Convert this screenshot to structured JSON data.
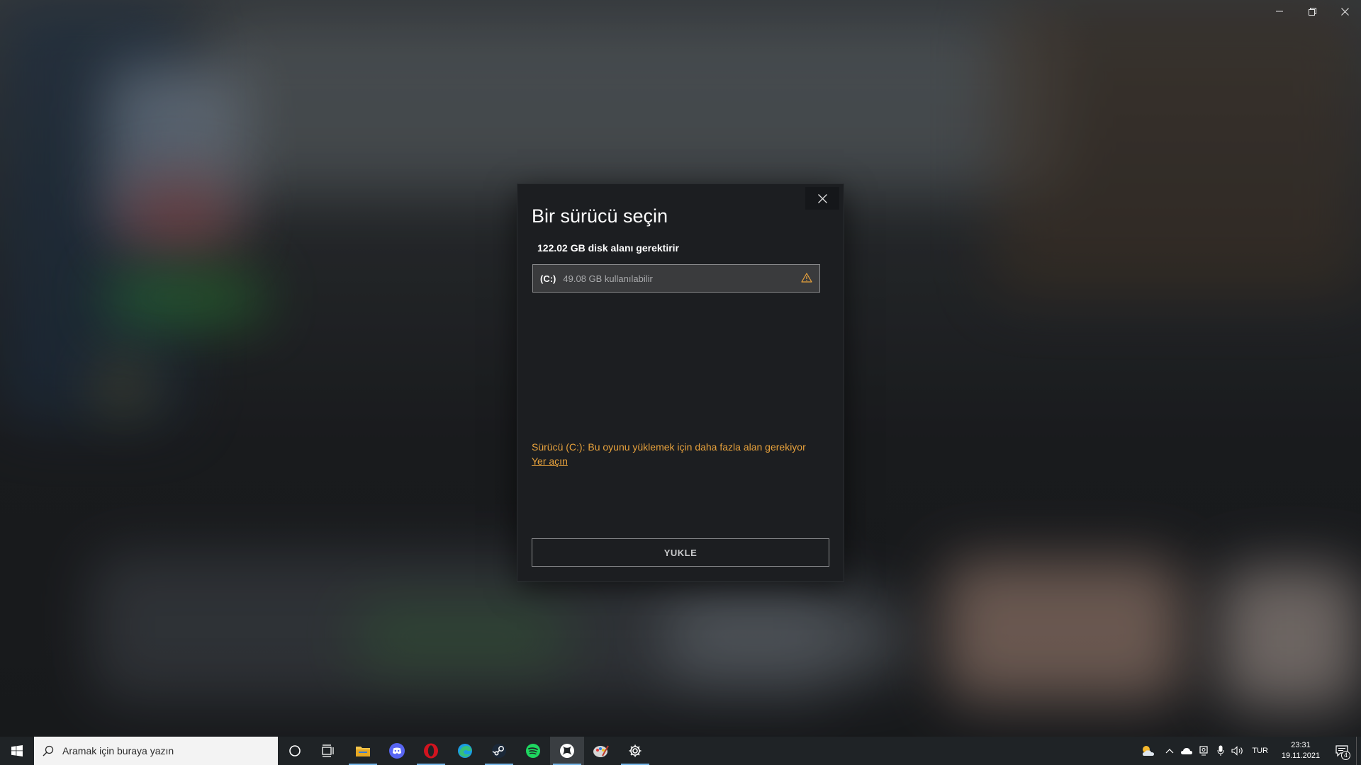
{
  "window": {
    "controls": {
      "minimize_icon": "minimize-icon",
      "restore_icon": "restore-icon",
      "close_icon": "close-icon"
    }
  },
  "dialog": {
    "title": "Bir sürücü seçin",
    "required_space": "122.02 GB disk alanı gerektirir",
    "drive": {
      "letter": "(C:)",
      "free_space": "49.08 GB kullanılabilir",
      "status_icon": "warning-icon"
    },
    "warning_text": "Sürücü (C:): Bu oyunu yüklemek için daha fazla alan gerekiyor",
    "free_up_link": "Yer açın",
    "install_label": "YUKLE"
  },
  "taskbar": {
    "search_placeholder": "Aramak için buraya yazın",
    "apps": [
      {
        "name": "cortana",
        "icon": "cortana-icon"
      },
      {
        "name": "task-view",
        "icon": "task-view-icon"
      },
      {
        "name": "file-explorer",
        "icon": "folder-icon"
      },
      {
        "name": "discord",
        "icon": "discord-icon"
      },
      {
        "name": "opera",
        "icon": "opera-icon"
      },
      {
        "name": "edge",
        "icon": "edge-icon"
      },
      {
        "name": "steam",
        "icon": "steam-icon"
      },
      {
        "name": "spotify",
        "icon": "spotify-icon"
      },
      {
        "name": "xbox",
        "icon": "xbox-icon"
      },
      {
        "name": "paint",
        "icon": "paint-icon"
      },
      {
        "name": "settings",
        "icon": "gear-icon"
      }
    ],
    "tray": {
      "language": "TUR",
      "time": "23:31",
      "date": "19.11.2021",
      "notification_count": "4"
    }
  },
  "colors": {
    "warning": "#e8a23c",
    "dialog_bg": "#1c1e21",
    "taskbar_bg": "#1f2326"
  }
}
